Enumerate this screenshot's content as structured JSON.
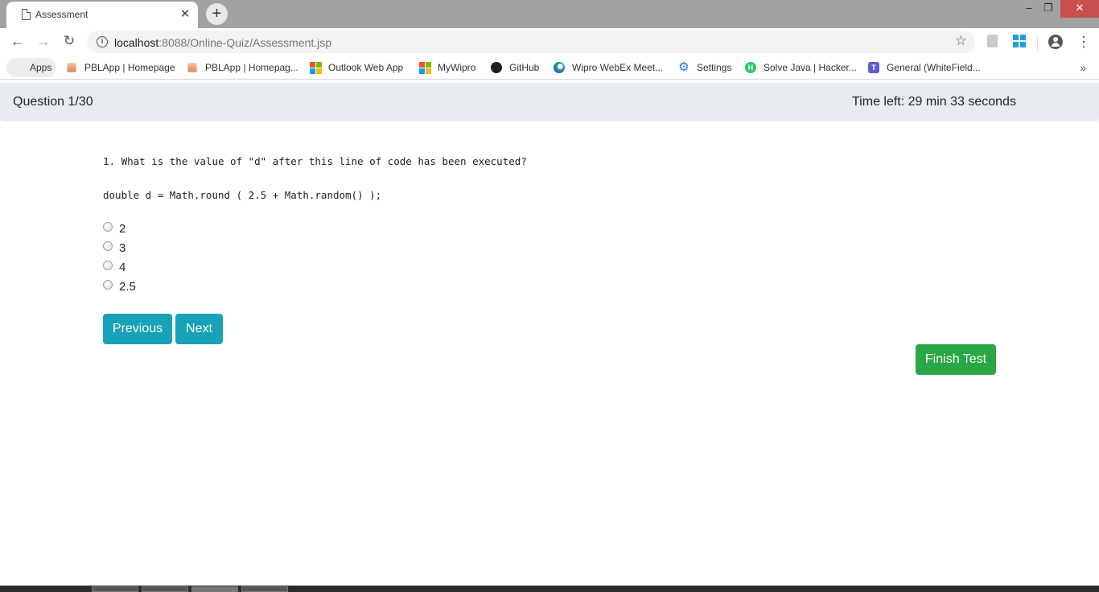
{
  "browser": {
    "tab": {
      "title": "Assessment",
      "close": "✕",
      "icon": "document-icon"
    },
    "new_tab": "+",
    "window_controls": {
      "minimize": "‒",
      "maximize": "❐",
      "close": "✕"
    },
    "nav": {
      "back": "←",
      "forward": "→",
      "reload": "↻"
    },
    "address": {
      "host": "localhost",
      "rest": ":8088/Online-Quiz/Assessment.jsp"
    },
    "star": "☆",
    "menu": "⋮",
    "bookmarks": [
      {
        "label": "Apps",
        "icon": "apps-grid-icon"
      },
      {
        "label": "PBLApp | Homepage",
        "icon": "pbl-icon"
      },
      {
        "label": "PBLApp | Homepag...",
        "icon": "pbl-icon"
      },
      {
        "label": "Outlook Web App",
        "icon": "microsoft-icon"
      },
      {
        "label": "MyWipro",
        "icon": "microsoft-icon"
      },
      {
        "label": "GitHub",
        "icon": "github-icon"
      },
      {
        "label": "Wipro WebEx Meet...",
        "icon": "webex-icon"
      },
      {
        "label": "Settings",
        "icon": "gear-icon"
      },
      {
        "label": "Solve Java | Hacker...",
        "icon": "hackerrank-icon"
      },
      {
        "label": "General (WhiteField...",
        "icon": "teams-icon"
      }
    ],
    "bookmarks_more": "»"
  },
  "quiz": {
    "progress": "Question 1/30",
    "time_left": "Time left: 29 min 33 seconds",
    "question": "1. What is the value of \"d\" after this line of code has been executed?",
    "code": "double d = Math.round ( 2.5 + Math.random() );",
    "options": [
      "2",
      "3",
      "4",
      "2.5"
    ],
    "buttons": {
      "previous": "Previous",
      "next": "Next",
      "finish": "Finish Test"
    }
  },
  "colors": {
    "primary": "#17a2b8",
    "success": "#28a745",
    "header_bg": "#e9ecef"
  }
}
